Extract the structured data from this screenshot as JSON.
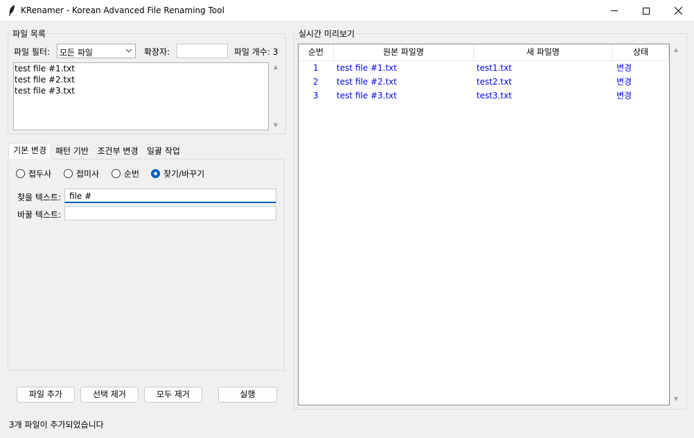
{
  "window": {
    "title": "KRenamer - Korean Advanced File Renaming Tool"
  },
  "file_list_group": {
    "label": "파일 목록",
    "filter_label": "파일 필터:",
    "filter_value": "모든 파일",
    "ext_label": "확장자:",
    "ext_value": "",
    "count_label": "파일 개수: 3",
    "files": [
      "test file #1.txt",
      "test file #2.txt",
      "test file #3.txt"
    ]
  },
  "tabs": [
    {
      "label": "기본 변경",
      "active": true
    },
    {
      "label": "패턴 기반",
      "active": false
    },
    {
      "label": "조건부 변경",
      "active": false
    },
    {
      "label": "일괄 작업",
      "active": false
    }
  ],
  "basic": {
    "radios": [
      {
        "label": "접두사",
        "checked": false
      },
      {
        "label": "접미사",
        "checked": false
      },
      {
        "label": "순번",
        "checked": false
      },
      {
        "label": "찾기/바꾸기",
        "checked": true
      }
    ],
    "find_label": "찾을 텍스트:",
    "find_value": "file #",
    "replace_label": "바꿀 텍스트:",
    "replace_value": ""
  },
  "buttons": {
    "add": "파일 추가",
    "remove_selected": "선택 제거",
    "remove_all": "모두 제거",
    "execute": "실행"
  },
  "status_text": "3개 파일이 추가되었습니다",
  "preview": {
    "label": "실시간 미리보기",
    "columns": [
      "순번",
      "원본 파일명",
      "새 파일명",
      "상태"
    ],
    "rows": [
      {
        "num": "1",
        "orig": "test file #1.txt",
        "new": "test1.txt",
        "status": "변경"
      },
      {
        "num": "2",
        "orig": "test file #2.txt",
        "new": "test2.txt",
        "status": "변경"
      },
      {
        "num": "3",
        "orig": "test file #3.txt",
        "new": "test3.txt",
        "status": "변경"
      }
    ]
  },
  "colors": {
    "accent": "#005fb8",
    "changed_row_text": "#0000ff"
  }
}
